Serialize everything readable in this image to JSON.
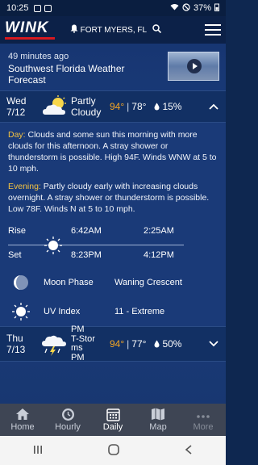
{
  "status_bar": {
    "time": "10:25",
    "battery": "37%"
  },
  "header": {
    "logo": "WINK",
    "location": "FORT MYERS, FL"
  },
  "video": {
    "ago": "49 minutes ago",
    "title": "Southwest Florida Weather Forecast"
  },
  "today": {
    "day": "Wed",
    "date": "7/12",
    "condition": "Partly Cloudy",
    "high": "94°",
    "low": "78°",
    "precip": "15%",
    "day_label": "Day:",
    "day_text": "Clouds and some sun this morning with more clouds for this afternoon. A stray shower or thunderstorm is possible. High 94F. Winds WNW at 5 to 10 mph.",
    "evening_label": "Evening:",
    "evening_text": "Partly cloudy early with increasing clouds overnight. A stray shower or thunderstorm is possible. Low 78F. Winds N at 5 to 10 mph.",
    "rise_label": "Rise",
    "set_label": "Set",
    "sunrise": "6:42AM",
    "sunset": "8:23PM",
    "moonrise": "2:25AM",
    "moonset": "4:12PM",
    "moon_phase_label": "Moon Phase",
    "moon_phase": "Waning Crescent",
    "uv_label": "UV Index",
    "uv_value": "11 - Extreme"
  },
  "next_day": {
    "day": "Thu",
    "date": "7/13",
    "condition_lines": [
      "PM",
      "T-Stor",
      "ms",
      "PM"
    ],
    "high": "94°",
    "low": "77°",
    "precip": "50%"
  },
  "nav": [
    {
      "label": "Home",
      "icon": "home-icon"
    },
    {
      "label": "Hourly",
      "icon": "clock-icon"
    },
    {
      "label": "Daily",
      "icon": "calendar-icon"
    },
    {
      "label": "Map",
      "icon": "map-icon"
    },
    {
      "label": "More",
      "icon": "more-icon"
    }
  ],
  "colors": {
    "accent_temp": "#f5a623",
    "label_yellow": "#f5c341",
    "brand_red": "#d71920"
  }
}
